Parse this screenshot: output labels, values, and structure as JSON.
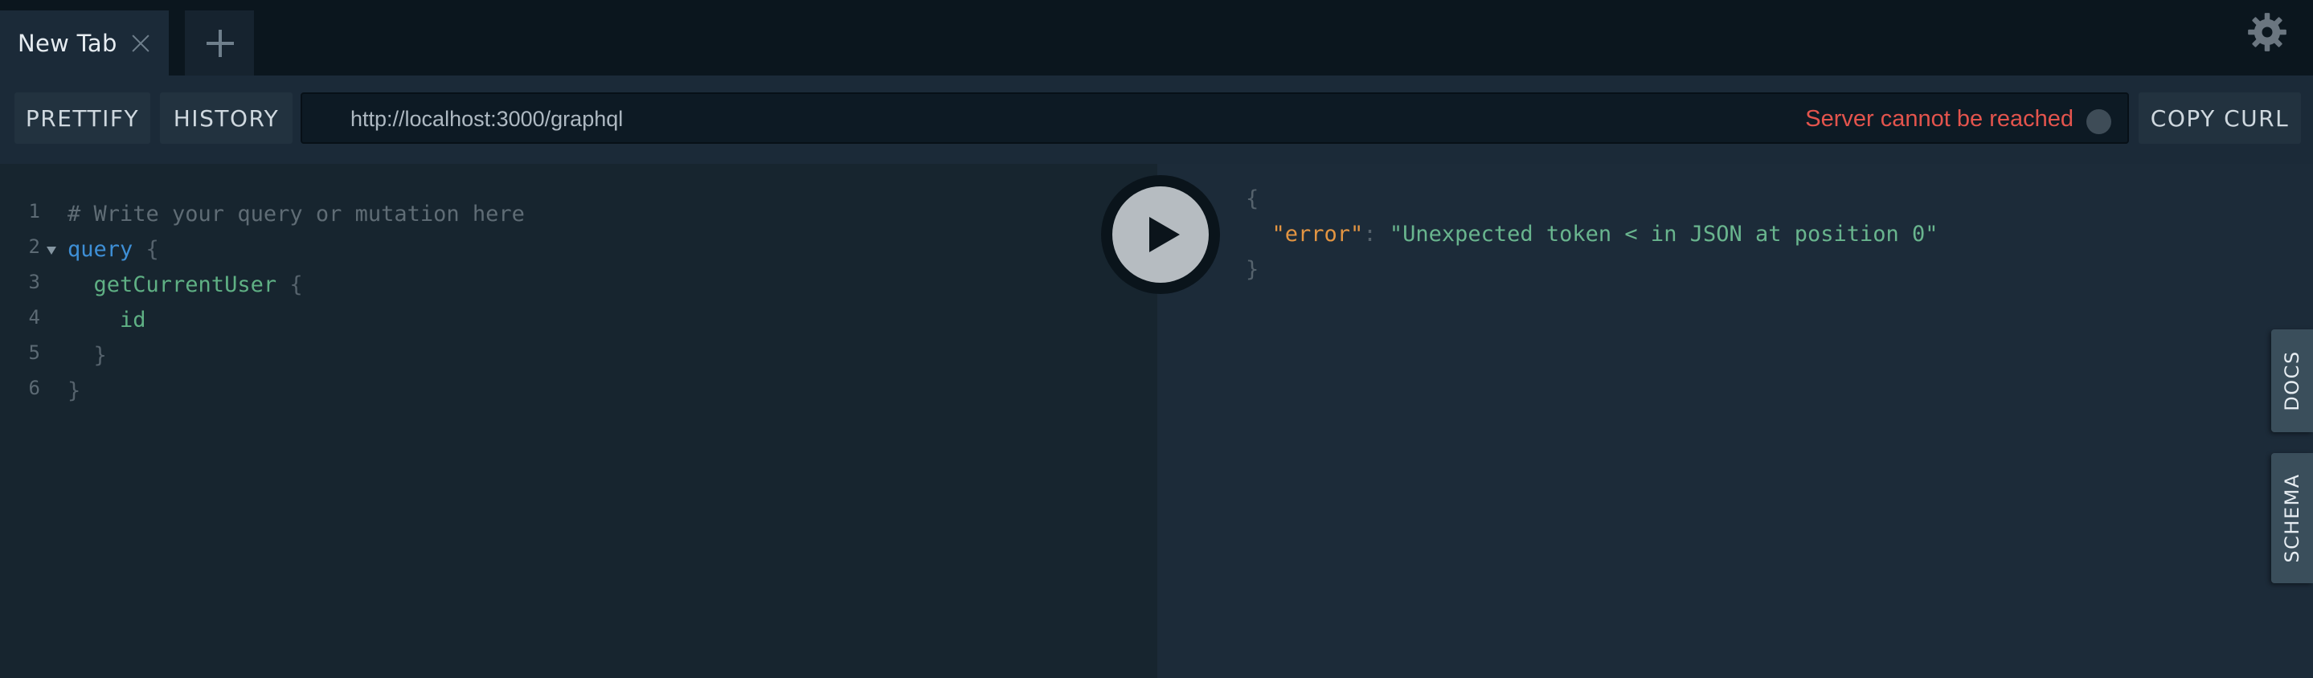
{
  "tabs": [
    {
      "title": "New Tab"
    }
  ],
  "toolbar": {
    "prettify_label": "PRETTIFY",
    "history_label": "HISTORY",
    "endpoint": "http://localhost:3000/graphql",
    "status_text": "Server cannot be reached",
    "copy_curl_label": "COPY CURL"
  },
  "editor": {
    "lines": [
      {
        "num": "1",
        "tokens": [
          {
            "t": "# Write your query or mutation here",
            "k": "comment"
          }
        ]
      },
      {
        "num": "2",
        "tokens": [
          {
            "t": "query",
            "k": "keyword"
          },
          {
            "t": " {",
            "k": "punct"
          }
        ]
      },
      {
        "num": "3",
        "tokens": [
          {
            "t": "  getCurrentUser",
            "k": "field"
          },
          {
            "t": " {",
            "k": "punct"
          }
        ]
      },
      {
        "num": "4",
        "tokens": [
          {
            "t": "    id",
            "k": "field"
          }
        ]
      },
      {
        "num": "5",
        "tokens": [
          {
            "t": "  }",
            "k": "punct"
          }
        ]
      },
      {
        "num": "6",
        "tokens": [
          {
            "t": "}",
            "k": "punct"
          }
        ]
      }
    ]
  },
  "result": {
    "open_brace": "{",
    "key": "\"error\"",
    "colon": ": ",
    "value": "\"Unexpected token < in JSON at position 0\"",
    "close_brace": "}"
  },
  "side_tabs": {
    "docs": "DOCS",
    "schema": "SCHEMA"
  },
  "icons": {
    "gear": "gear-icon",
    "add_tab": "plus-icon",
    "close_tab": "close-icon",
    "run": "play-icon"
  },
  "colors": {
    "status_error": "#e3544d",
    "keyword": "#3e8fd6",
    "field": "#5fb084",
    "json_key": "#e39542",
    "json_string": "#69b58e"
  }
}
